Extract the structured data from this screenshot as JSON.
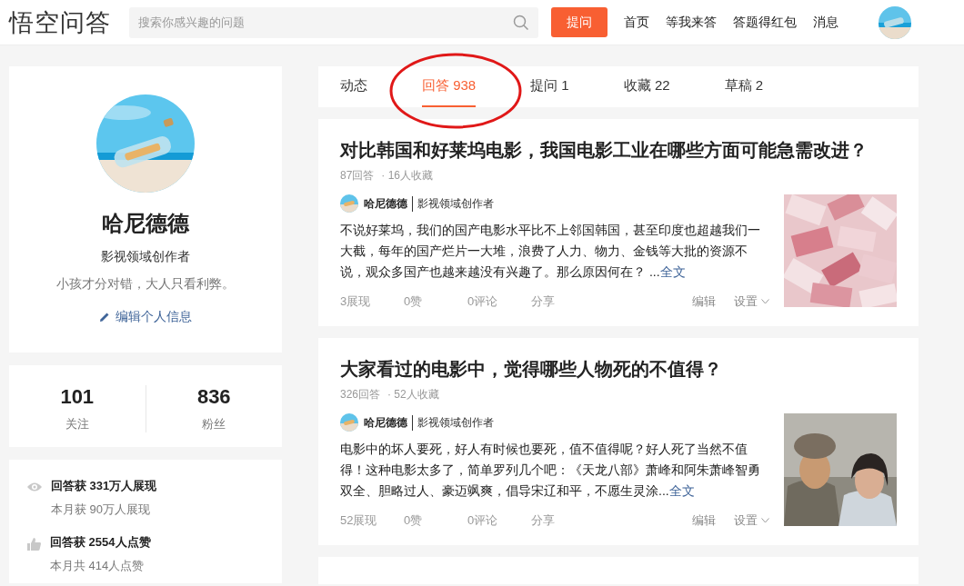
{
  "header": {
    "logo": "悟空问答",
    "search": {
      "placeholder": "搜索你感兴趣的问题"
    },
    "ask_button": "提问",
    "nav": [
      "首页",
      "等我来答",
      "答题得红包",
      "消息"
    ]
  },
  "profile": {
    "name": "哈尼德德",
    "title": "影视领域创作者",
    "motto": "小孩才分对错，大人只看利弊。",
    "edit_link": "编辑个人信息"
  },
  "stats": [
    {
      "value": "101",
      "label": "关注"
    },
    {
      "value": "836",
      "label": "粉丝"
    }
  ],
  "achievements": [
    {
      "kind": "views",
      "main": "回答获 331万人展现",
      "sub": "本月获 90万人展现"
    },
    {
      "kind": "likes",
      "main": "回答获 2554人点赞",
      "sub": "本月共 414人点赞"
    }
  ],
  "tabs": [
    {
      "label": "动态",
      "selected": false
    },
    {
      "label": "回答 938",
      "selected": true
    },
    {
      "label": "提问 1",
      "selected": false
    },
    {
      "label": "收藏 22",
      "selected": false
    },
    {
      "label": "草稿 2",
      "selected": false
    }
  ],
  "answers": [
    {
      "question": "对比韩国和好莱坞电影，我国电影工业在哪些方面可能急需改进？",
      "answers_count": "87回答",
      "favorites": "· 16人收藏",
      "author": "哈尼德德",
      "author_title": "影视领域创作者",
      "excerpt": "不说好莱坞，我们的国产电影水平比不上邻国韩国，甚至印度也超越我们一大截，每年的国产烂片一大堆，浪费了人力、物力、金钱等大批的资源不说，观众多国产也越来越没有兴趣了。那么原因何在？  ...",
      "more_link": "全文",
      "thumb": {
        "kind": "money"
      },
      "views": "3展现",
      "likes": "0赞",
      "comments": "0评论",
      "share": "分享",
      "edit": "编辑",
      "settings": "设置"
    },
    {
      "question": "大家看过的电影中，觉得哪些人物死的不值得？",
      "answers_count": "326回答",
      "favorites": "· 52人收藏",
      "author": "哈尼德德",
      "author_title": "影视领域创作者",
      "excerpt": "电影中的坏人要死，好人有时候也要死，值不值得呢？好人死了当然不值得！这种电影太多了，简单罗列几个吧：《天龙八部》萧峰和阿朱萧峰智勇双全、胆略过人、豪迈飒爽，倡导宋辽和平，不愿生灵涂...",
      "more_link": "全文",
      "thumb": {
        "kind": "people"
      },
      "views": "52展现",
      "likes": "0赞",
      "comments": "0评论",
      "share": "分享",
      "edit": "编辑",
      "settings": "设置"
    }
  ]
}
